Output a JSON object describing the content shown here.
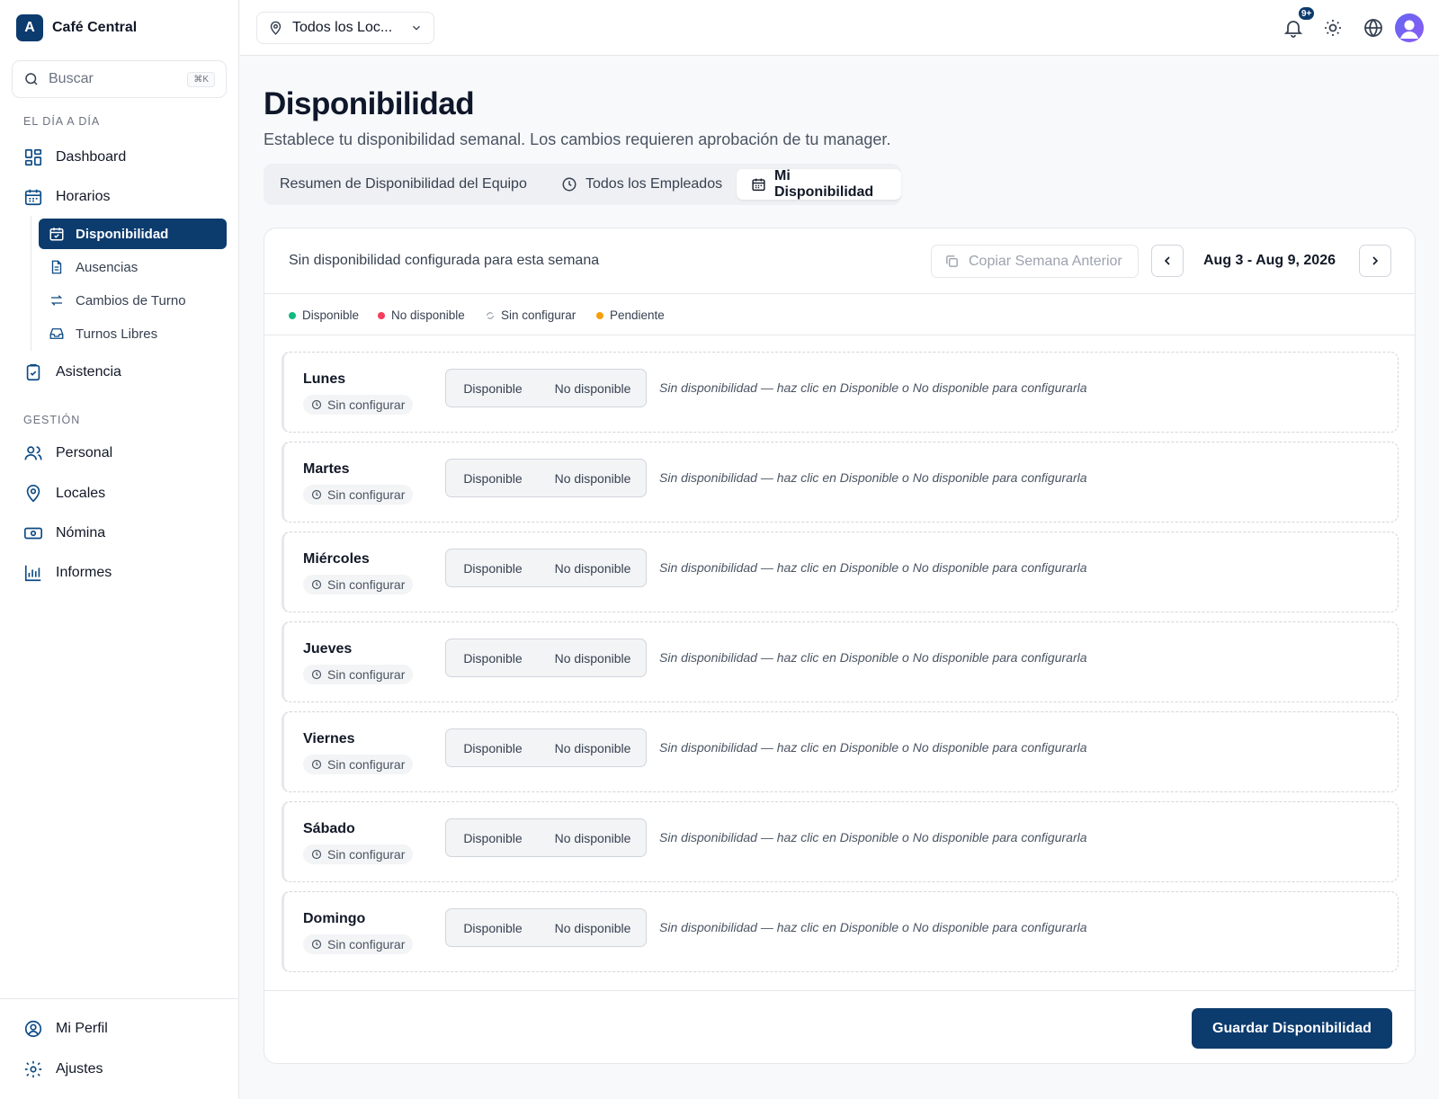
{
  "brand": {
    "logo_letter": "A",
    "name": "Café Central"
  },
  "search": {
    "placeholder": "Buscar",
    "shortcut": "⌘K"
  },
  "sidebar": {
    "section_daily": "EL DÍA A DÍA",
    "section_management": "GESTIÓN",
    "dashboard": "Dashboard",
    "horarios": "Horarios",
    "disponibilidad": "Disponibilidad",
    "ausencias": "Ausencias",
    "cambios_turno": "Cambios de Turno",
    "turnos_libres": "Turnos Libres",
    "asistencia": "Asistencia",
    "personal": "Personal",
    "locales": "Locales",
    "nomina": "Nómina",
    "informes": "Informes",
    "mi_perfil": "Mi Perfil",
    "ajustes": "Ajustes"
  },
  "topbar": {
    "location": "Todos los Loc...",
    "notification_badge": "9+"
  },
  "page": {
    "title": "Disponibilidad",
    "subtitle": "Establece tu disponibilidad semanal. Los cambios requieren aprobación de tu manager."
  },
  "tabs": {
    "team_summary": "Resumen de Disponibilidad del Equipo",
    "all_employees": "Todos los Empleados",
    "my_availability": "Mi Disponibilidad"
  },
  "card": {
    "header_text": "Sin disponibilidad configurada para esta semana",
    "copy_button": "Copiar Semana Anterior",
    "date_range": "Aug 3 - Aug 9, 2026",
    "save_button": "Guardar Disponibilidad"
  },
  "legend": {
    "available": "Disponible",
    "unavailable": "No disponible",
    "unset": "Sin configurar",
    "pending": "Pendiente"
  },
  "colors": {
    "accent": "#0c3b6e",
    "available": "#10b981",
    "unavailable": "#f43f5e",
    "pending": "#f59e0b"
  },
  "days": [
    {
      "name": "Lunes",
      "status": "Sin configurar",
      "opt_available": "Disponible",
      "opt_unavailable": "No disponible",
      "hint": "Sin disponibilidad — haz clic en Disponible o No disponible para configurarla"
    },
    {
      "name": "Martes",
      "status": "Sin configurar",
      "opt_available": "Disponible",
      "opt_unavailable": "No disponible",
      "hint": "Sin disponibilidad — haz clic en Disponible o No disponible para configurarla"
    },
    {
      "name": "Miércoles",
      "status": "Sin configurar",
      "opt_available": "Disponible",
      "opt_unavailable": "No disponible",
      "hint": "Sin disponibilidad — haz clic en Disponible o No disponible para configurarla"
    },
    {
      "name": "Jueves",
      "status": "Sin configurar",
      "opt_available": "Disponible",
      "opt_unavailable": "No disponible",
      "hint": "Sin disponibilidad — haz clic en Disponible o No disponible para configurarla"
    },
    {
      "name": "Viernes",
      "status": "Sin configurar",
      "opt_available": "Disponible",
      "opt_unavailable": "No disponible",
      "hint": "Sin disponibilidad — haz clic en Disponible o No disponible para configurarla"
    },
    {
      "name": "Sábado",
      "status": "Sin configurar",
      "opt_available": "Disponible",
      "opt_unavailable": "No disponible",
      "hint": "Sin disponibilidad — haz clic en Disponible o No disponible para configurarla"
    },
    {
      "name": "Domingo",
      "status": "Sin configurar",
      "opt_available": "Disponible",
      "opt_unavailable": "No disponible",
      "hint": "Sin disponibilidad — haz clic en Disponible o No disponible para configurarla"
    }
  ]
}
